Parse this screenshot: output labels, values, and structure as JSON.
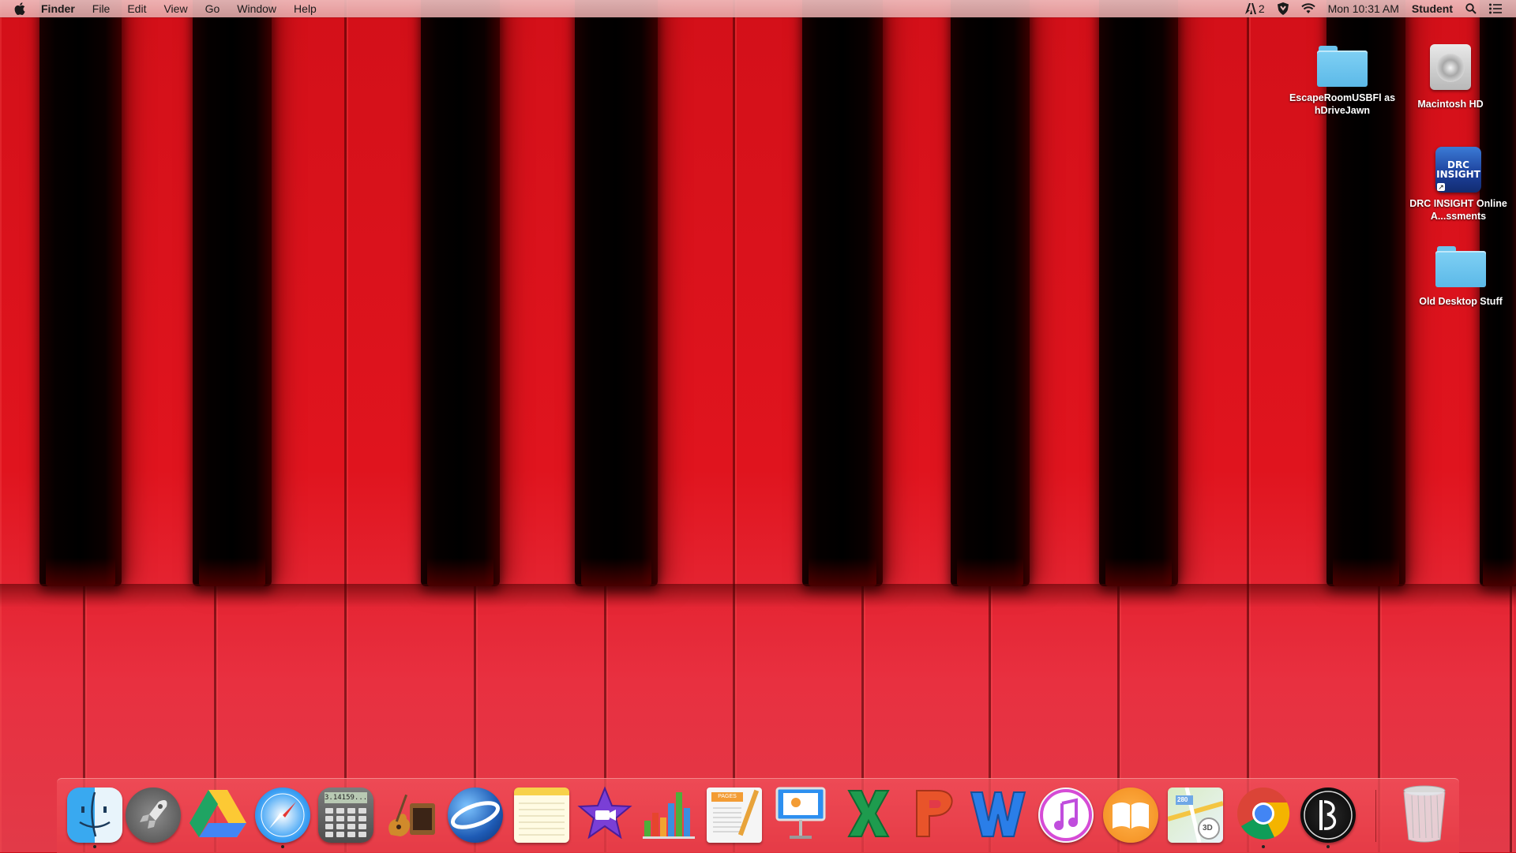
{
  "menubar": {
    "apple_icon": "apple-icon",
    "app_name": "Finder",
    "menus": [
      "File",
      "Edit",
      "View",
      "Go",
      "Window",
      "Help"
    ],
    "status": {
      "adobe_count": "2",
      "clock": "Mon 10:31 AM",
      "user": "Student"
    }
  },
  "desktop": {
    "icons": [
      {
        "label": "EscapeRoomUSBFlashDriveJawn",
        "label_display": "EscapeRoomUSBFl ashDriveJawn",
        "kind": "folder-icon"
      },
      {
        "label": "Macintosh HD",
        "kind": "hard-drive-icon"
      },
      {
        "label": "DRC INSIGHT Online A...ssments",
        "kind": "drc-insight-icon",
        "icon_text": "DRC INSIGHT"
      },
      {
        "label": "Old Desktop Stuff",
        "kind": "folder-icon"
      }
    ]
  },
  "dock": {
    "apps": [
      {
        "name": "Finder",
        "icon": "finder-icon",
        "running": true
      },
      {
        "name": "Launchpad",
        "icon": "launchpad-icon",
        "running": false
      },
      {
        "name": "Google Drive",
        "icon": "google-drive-icon",
        "running": false
      },
      {
        "name": "Safari",
        "icon": "safari-icon",
        "running": true
      },
      {
        "name": "Calculator",
        "icon": "calculator-icon",
        "running": false,
        "display": "3.14159..."
      },
      {
        "name": "GarageBand",
        "icon": "garageband-icon",
        "running": false
      },
      {
        "name": "Google Earth",
        "icon": "google-earth-icon",
        "running": false
      },
      {
        "name": "Notes",
        "icon": "notes-icon",
        "running": false
      },
      {
        "name": "iMovie",
        "icon": "imovie-icon",
        "running": false
      },
      {
        "name": "Numbers",
        "icon": "numbers-icon",
        "running": false
      },
      {
        "name": "Pages",
        "icon": "pages-icon",
        "running": false,
        "badge": "PAGES"
      },
      {
        "name": "Keynote",
        "icon": "keynote-icon",
        "running": false
      },
      {
        "name": "Microsoft Excel",
        "icon": "excel-icon",
        "running": false
      },
      {
        "name": "Microsoft PowerPoint",
        "icon": "powerpoint-icon",
        "running": false
      },
      {
        "name": "Microsoft Word",
        "icon": "word-icon",
        "running": false
      },
      {
        "name": "iTunes",
        "icon": "itunes-icon",
        "running": false
      },
      {
        "name": "iBooks",
        "icon": "ibooks-icon",
        "running": false
      },
      {
        "name": "Maps",
        "icon": "maps-icon",
        "running": false,
        "badge": "3D",
        "route": "280"
      },
      {
        "name": "Google Chrome",
        "icon": "chrome-icon",
        "running": true
      },
      {
        "name": "Student App",
        "icon": "b-circle-icon",
        "running": true
      },
      {
        "name": "Trash",
        "icon": "trash-icon",
        "running": false
      }
    ]
  },
  "colors": {
    "wallpaper_red": "#d31019",
    "black_key": "#000000",
    "folder_blue": "#6cc3ec",
    "menubar_tint": "#eeb8b8"
  }
}
